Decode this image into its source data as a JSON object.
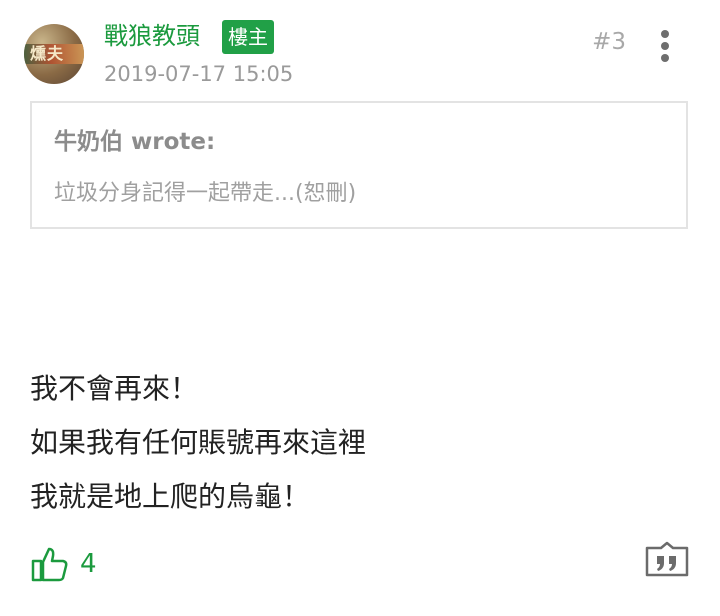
{
  "post": {
    "author": {
      "name": "戰狼教頭",
      "badge": "樓主",
      "avatar_text": "燻夫"
    },
    "timestamp": "2019-07-17 15:05",
    "floor": "#3",
    "quote": {
      "author_line": "牛奶伯 wrote:",
      "text": "垃圾分身記得一起帶走...(恕刪)"
    },
    "body_lines": [
      "我不會再來！",
      "如果我有任何賬號再來這裡",
      "我就是地上爬的烏龜！"
    ],
    "likes": "4"
  },
  "icons": {
    "more": "more-vertical-icon",
    "like": "thumbs-up-icon",
    "reply": "quote-reply-icon"
  },
  "colors": {
    "accent": "#1b9a3e",
    "badge_bg": "#21a047",
    "meta_text": "#9a9a9a",
    "quote_border": "#e3e3e3",
    "body_text": "#222222"
  }
}
